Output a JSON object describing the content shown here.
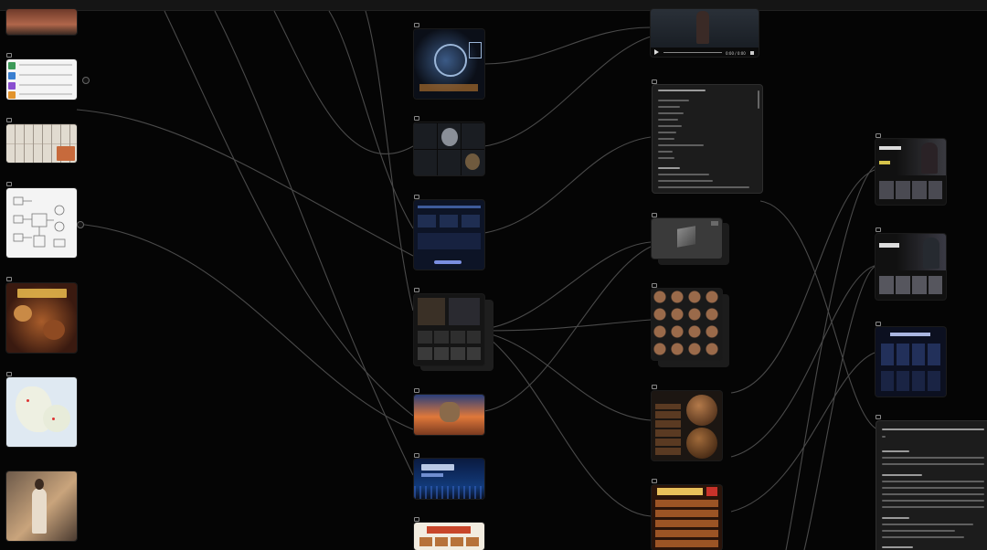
{
  "app": {
    "title": "",
    "canvas": "node-flow-canvas",
    "colors": {
      "background": "#050505",
      "wire": "#4a4a4a",
      "card": "#1c1c1c"
    }
  },
  "nodes": [
    {
      "id": "n1",
      "label": "",
      "type": "image",
      "icon": "image-icon",
      "subject": "street-photo"
    },
    {
      "id": "n2",
      "label": "",
      "type": "image",
      "icon": "image-icon",
      "subject": "ui-palette"
    },
    {
      "id": "n3",
      "label": "",
      "type": "image",
      "icon": "image-icon",
      "subject": "character-sheet"
    },
    {
      "id": "n4",
      "label": "",
      "type": "image",
      "icon": "image-icon",
      "subject": "wireframe-diagram"
    },
    {
      "id": "n5",
      "label": "",
      "type": "image",
      "icon": "image-icon",
      "subject": "food-poster"
    },
    {
      "id": "n6",
      "label": "",
      "type": "image",
      "icon": "image-icon",
      "subject": "map"
    },
    {
      "id": "n7",
      "label": "",
      "type": "image",
      "icon": "image-icon",
      "subject": "portrait-street"
    },
    {
      "id": "n8",
      "label": "",
      "type": "image",
      "icon": "image-icon",
      "subject": "sci-fi-hud"
    },
    {
      "id": "n9",
      "label": "",
      "type": "image",
      "icon": "image-icon",
      "subject": "robot-grid"
    },
    {
      "id": "n10",
      "label": "",
      "type": "image",
      "icon": "image-icon",
      "subject": "dashboard-ui"
    },
    {
      "id": "n11",
      "label": "",
      "type": "image",
      "icon": "image-icon",
      "subject": "app-gallery"
    },
    {
      "id": "n12",
      "label": "",
      "type": "image",
      "icon": "image-icon",
      "subject": "cat-sunset"
    },
    {
      "id": "n13",
      "label": "",
      "type": "image",
      "icon": "image-icon",
      "subject": "future-tech-banner"
    },
    {
      "id": "n14",
      "label": "",
      "type": "image",
      "icon": "image-icon",
      "subject": "menu-poster"
    },
    {
      "id": "n15",
      "label": "",
      "type": "video",
      "icon": "video-icon",
      "subject": "running-figure",
      "time": "0:00 / 0:00"
    },
    {
      "id": "n16",
      "label": "",
      "type": "text",
      "icon": "text-icon"
    },
    {
      "id": "n17",
      "label": "",
      "type": "image",
      "icon": "image-icon",
      "subject": "3d-cube"
    },
    {
      "id": "n18",
      "label": "",
      "type": "image",
      "icon": "image-icon",
      "subject": "material-spheres"
    },
    {
      "id": "n19",
      "label": "",
      "type": "image",
      "icon": "image-icon",
      "subject": "wood-spheres"
    },
    {
      "id": "n20",
      "label": "",
      "type": "image",
      "icon": "image-icon",
      "subject": "food-menu"
    },
    {
      "id": "n21",
      "label": "",
      "type": "image",
      "icon": "image-icon",
      "subject": "streaming-ui-a"
    },
    {
      "id": "n22",
      "label": "",
      "type": "image",
      "icon": "image-icon",
      "subject": "streaming-ui-b"
    },
    {
      "id": "n23",
      "label": "",
      "type": "image",
      "icon": "image-icon",
      "subject": "dark-dashboard"
    },
    {
      "id": "n24",
      "label": "",
      "type": "text",
      "icon": "text-icon"
    }
  ]
}
